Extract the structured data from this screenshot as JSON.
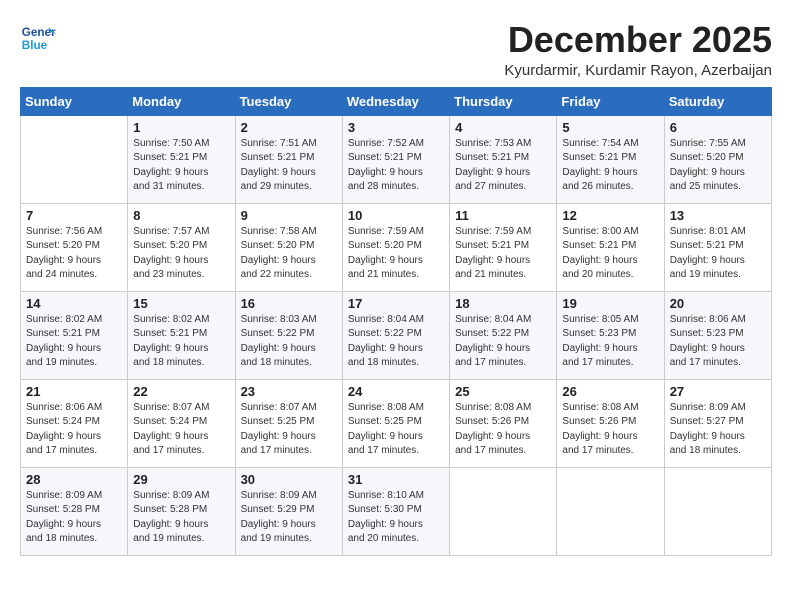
{
  "logo": {
    "general": "General",
    "blue": "Blue"
  },
  "header": {
    "month": "December 2025",
    "location": "Kyurdarmir, Kurdamir Rayon, Azerbaijan"
  },
  "weekdays": [
    "Sunday",
    "Monday",
    "Tuesday",
    "Wednesday",
    "Thursday",
    "Friday",
    "Saturday"
  ],
  "weeks": [
    [
      {
        "day": "",
        "content": ""
      },
      {
        "day": "1",
        "content": "Sunrise: 7:50 AM\nSunset: 5:21 PM\nDaylight: 9 hours\nand 31 minutes."
      },
      {
        "day": "2",
        "content": "Sunrise: 7:51 AM\nSunset: 5:21 PM\nDaylight: 9 hours\nand 29 minutes."
      },
      {
        "day": "3",
        "content": "Sunrise: 7:52 AM\nSunset: 5:21 PM\nDaylight: 9 hours\nand 28 minutes."
      },
      {
        "day": "4",
        "content": "Sunrise: 7:53 AM\nSunset: 5:21 PM\nDaylight: 9 hours\nand 27 minutes."
      },
      {
        "day": "5",
        "content": "Sunrise: 7:54 AM\nSunset: 5:21 PM\nDaylight: 9 hours\nand 26 minutes."
      },
      {
        "day": "6",
        "content": "Sunrise: 7:55 AM\nSunset: 5:20 PM\nDaylight: 9 hours\nand 25 minutes."
      }
    ],
    [
      {
        "day": "7",
        "content": "Sunrise: 7:56 AM\nSunset: 5:20 PM\nDaylight: 9 hours\nand 24 minutes."
      },
      {
        "day": "8",
        "content": "Sunrise: 7:57 AM\nSunset: 5:20 PM\nDaylight: 9 hours\nand 23 minutes."
      },
      {
        "day": "9",
        "content": "Sunrise: 7:58 AM\nSunset: 5:20 PM\nDaylight: 9 hours\nand 22 minutes."
      },
      {
        "day": "10",
        "content": "Sunrise: 7:59 AM\nSunset: 5:20 PM\nDaylight: 9 hours\nand 21 minutes."
      },
      {
        "day": "11",
        "content": "Sunrise: 7:59 AM\nSunset: 5:21 PM\nDaylight: 9 hours\nand 21 minutes."
      },
      {
        "day": "12",
        "content": "Sunrise: 8:00 AM\nSunset: 5:21 PM\nDaylight: 9 hours\nand 20 minutes."
      },
      {
        "day": "13",
        "content": "Sunrise: 8:01 AM\nSunset: 5:21 PM\nDaylight: 9 hours\nand 19 minutes."
      }
    ],
    [
      {
        "day": "14",
        "content": "Sunrise: 8:02 AM\nSunset: 5:21 PM\nDaylight: 9 hours\nand 19 minutes."
      },
      {
        "day": "15",
        "content": "Sunrise: 8:02 AM\nSunset: 5:21 PM\nDaylight: 9 hours\nand 18 minutes."
      },
      {
        "day": "16",
        "content": "Sunrise: 8:03 AM\nSunset: 5:22 PM\nDaylight: 9 hours\nand 18 minutes."
      },
      {
        "day": "17",
        "content": "Sunrise: 8:04 AM\nSunset: 5:22 PM\nDaylight: 9 hours\nand 18 minutes."
      },
      {
        "day": "18",
        "content": "Sunrise: 8:04 AM\nSunset: 5:22 PM\nDaylight: 9 hours\nand 17 minutes."
      },
      {
        "day": "19",
        "content": "Sunrise: 8:05 AM\nSunset: 5:23 PM\nDaylight: 9 hours\nand 17 minutes."
      },
      {
        "day": "20",
        "content": "Sunrise: 8:06 AM\nSunset: 5:23 PM\nDaylight: 9 hours\nand 17 minutes."
      }
    ],
    [
      {
        "day": "21",
        "content": "Sunrise: 8:06 AM\nSunset: 5:24 PM\nDaylight: 9 hours\nand 17 minutes."
      },
      {
        "day": "22",
        "content": "Sunrise: 8:07 AM\nSunset: 5:24 PM\nDaylight: 9 hours\nand 17 minutes."
      },
      {
        "day": "23",
        "content": "Sunrise: 8:07 AM\nSunset: 5:25 PM\nDaylight: 9 hours\nand 17 minutes."
      },
      {
        "day": "24",
        "content": "Sunrise: 8:08 AM\nSunset: 5:25 PM\nDaylight: 9 hours\nand 17 minutes."
      },
      {
        "day": "25",
        "content": "Sunrise: 8:08 AM\nSunset: 5:26 PM\nDaylight: 9 hours\nand 17 minutes."
      },
      {
        "day": "26",
        "content": "Sunrise: 8:08 AM\nSunset: 5:26 PM\nDaylight: 9 hours\nand 17 minutes."
      },
      {
        "day": "27",
        "content": "Sunrise: 8:09 AM\nSunset: 5:27 PM\nDaylight: 9 hours\nand 18 minutes."
      }
    ],
    [
      {
        "day": "28",
        "content": "Sunrise: 8:09 AM\nSunset: 5:28 PM\nDaylight: 9 hours\nand 18 minutes."
      },
      {
        "day": "29",
        "content": "Sunrise: 8:09 AM\nSunset: 5:28 PM\nDaylight: 9 hours\nand 19 minutes."
      },
      {
        "day": "30",
        "content": "Sunrise: 8:09 AM\nSunset: 5:29 PM\nDaylight: 9 hours\nand 19 minutes."
      },
      {
        "day": "31",
        "content": "Sunrise: 8:10 AM\nSunset: 5:30 PM\nDaylight: 9 hours\nand 20 minutes."
      },
      {
        "day": "",
        "content": ""
      },
      {
        "day": "",
        "content": ""
      },
      {
        "day": "",
        "content": ""
      }
    ]
  ]
}
